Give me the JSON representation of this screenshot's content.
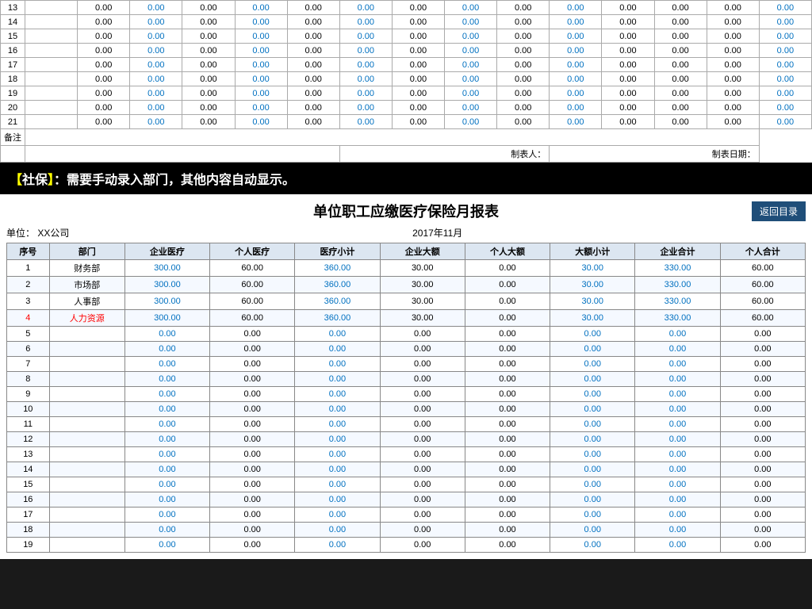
{
  "top": {
    "rows": [
      {
        "num": "13",
        "vals": [
          "",
          "0.00",
          "0.00",
          "0.00",
          "0.00",
          "0.00",
          "0.00",
          "0.00",
          "0.00",
          "0.00",
          "0.00",
          "0.00",
          "0.00",
          "0.00",
          "0.00"
        ]
      },
      {
        "num": "14",
        "vals": [
          "",
          "0.00",
          "0.00",
          "0.00",
          "0.00",
          "0.00",
          "0.00",
          "0.00",
          "0.00",
          "0.00",
          "0.00",
          "0.00",
          "0.00",
          "0.00",
          "0.00"
        ]
      },
      {
        "num": "15",
        "vals": [
          "",
          "0.00",
          "0.00",
          "0.00",
          "0.00",
          "0.00",
          "0.00",
          "0.00",
          "0.00",
          "0.00",
          "0.00",
          "0.00",
          "0.00",
          "0.00",
          "0.00"
        ]
      },
      {
        "num": "16",
        "vals": [
          "",
          "0.00",
          "0.00",
          "0.00",
          "0.00",
          "0.00",
          "0.00",
          "0.00",
          "0.00",
          "0.00",
          "0.00",
          "0.00",
          "0.00",
          "0.00",
          "0.00"
        ]
      },
      {
        "num": "17",
        "vals": [
          "",
          "0.00",
          "0.00",
          "0.00",
          "0.00",
          "0.00",
          "0.00",
          "0.00",
          "0.00",
          "0.00",
          "0.00",
          "0.00",
          "0.00",
          "0.00",
          "0.00"
        ]
      },
      {
        "num": "18",
        "vals": [
          "",
          "0.00",
          "0.00",
          "0.00",
          "0.00",
          "0.00",
          "0.00",
          "0.00",
          "0.00",
          "0.00",
          "0.00",
          "0.00",
          "0.00",
          "0.00",
          "0.00"
        ]
      },
      {
        "num": "19",
        "vals": [
          "",
          "0.00",
          "0.00",
          "0.00",
          "0.00",
          "0.00",
          "0.00",
          "0.00",
          "0.00",
          "0.00",
          "0.00",
          "0.00",
          "0.00",
          "0.00",
          "0.00"
        ]
      },
      {
        "num": "20",
        "vals": [
          "",
          "0.00",
          "0.00",
          "0.00",
          "0.00",
          "0.00",
          "0.00",
          "0.00",
          "0.00",
          "0.00",
          "0.00",
          "0.00",
          "0.00",
          "0.00",
          "0.00"
        ]
      },
      {
        "num": "21",
        "vals": [
          "",
          "0.00",
          "0.00",
          "0.00",
          "0.00",
          "0.00",
          "0.00",
          "0.00",
          "0.00",
          "0.00",
          "0.00",
          "0.00",
          "0.00",
          "0.00",
          "0.00"
        ]
      }
    ],
    "beizhu_label": "备注",
    "footer_label_maker": "制表人：",
    "footer_label_date": "制表日期："
  },
  "banner": {
    "bracket_open": "【",
    "text1": "社保",
    "bracket_close": "】",
    "message": "：需要手动录入部门，其他内容自动显示。"
  },
  "bottom": {
    "title": "单位职工应缴医疗保险月报表",
    "return_btn": "返回目录",
    "company_label": "单位：",
    "company_name": "XX公司",
    "year_month": "2017年11月",
    "headers": [
      "序号",
      "部门",
      "企业医疗",
      "个人医疗",
      "医疗小计",
      "企业大额",
      "个人大额",
      "大额小计",
      "企业合计",
      "个人合计"
    ],
    "data_rows": [
      {
        "seq": "1",
        "dept": "财务部",
        "vals": [
          "300.00",
          "60.00",
          "360.00",
          "30.00",
          "0.00",
          "30.00",
          "330.00",
          "60.00"
        ],
        "highlight": false
      },
      {
        "seq": "2",
        "dept": "市场部",
        "vals": [
          "300.00",
          "60.00",
          "360.00",
          "30.00",
          "0.00",
          "30.00",
          "330.00",
          "60.00"
        ],
        "highlight": false
      },
      {
        "seq": "3",
        "dept": "人事部",
        "vals": [
          "300.00",
          "60.00",
          "360.00",
          "30.00",
          "0.00",
          "30.00",
          "330.00",
          "60.00"
        ],
        "highlight": false
      },
      {
        "seq": "4",
        "dept": "人力资源",
        "vals": [
          "300.00",
          "60.00",
          "360.00",
          "30.00",
          "0.00",
          "30.00",
          "330.00",
          "60.00"
        ],
        "highlight": true
      },
      {
        "seq": "5",
        "dept": "",
        "vals": [
          "0.00",
          "0.00",
          "0.00",
          "0.00",
          "0.00",
          "0.00",
          "0.00",
          "0.00"
        ],
        "highlight": false
      },
      {
        "seq": "6",
        "dept": "",
        "vals": [
          "0.00",
          "0.00",
          "0.00",
          "0.00",
          "0.00",
          "0.00",
          "0.00",
          "0.00"
        ],
        "highlight": false
      },
      {
        "seq": "7",
        "dept": "",
        "vals": [
          "0.00",
          "0.00",
          "0.00",
          "0.00",
          "0.00",
          "0.00",
          "0.00",
          "0.00"
        ],
        "highlight": false
      },
      {
        "seq": "8",
        "dept": "",
        "vals": [
          "0.00",
          "0.00",
          "0.00",
          "0.00",
          "0.00",
          "0.00",
          "0.00",
          "0.00"
        ],
        "highlight": false
      },
      {
        "seq": "9",
        "dept": "",
        "vals": [
          "0.00",
          "0.00",
          "0.00",
          "0.00",
          "0.00",
          "0.00",
          "0.00",
          "0.00"
        ],
        "highlight": false
      },
      {
        "seq": "10",
        "dept": "",
        "vals": [
          "0.00",
          "0.00",
          "0.00",
          "0.00",
          "0.00",
          "0.00",
          "0.00",
          "0.00"
        ],
        "highlight": false
      },
      {
        "seq": "11",
        "dept": "",
        "vals": [
          "0.00",
          "0.00",
          "0.00",
          "0.00",
          "0.00",
          "0.00",
          "0.00",
          "0.00"
        ],
        "highlight": false
      },
      {
        "seq": "12",
        "dept": "",
        "vals": [
          "0.00",
          "0.00",
          "0.00",
          "0.00",
          "0.00",
          "0.00",
          "0.00",
          "0.00"
        ],
        "highlight": false
      },
      {
        "seq": "13",
        "dept": "",
        "vals": [
          "0.00",
          "0.00",
          "0.00",
          "0.00",
          "0.00",
          "0.00",
          "0.00",
          "0.00"
        ],
        "highlight": false
      },
      {
        "seq": "14",
        "dept": "",
        "vals": [
          "0.00",
          "0.00",
          "0.00",
          "0.00",
          "0.00",
          "0.00",
          "0.00",
          "0.00"
        ],
        "highlight": false
      },
      {
        "seq": "15",
        "dept": "",
        "vals": [
          "0.00",
          "0.00",
          "0.00",
          "0.00",
          "0.00",
          "0.00",
          "0.00",
          "0.00"
        ],
        "highlight": false
      },
      {
        "seq": "16",
        "dept": "",
        "vals": [
          "0.00",
          "0.00",
          "0.00",
          "0.00",
          "0.00",
          "0.00",
          "0.00",
          "0.00"
        ],
        "highlight": false
      },
      {
        "seq": "17",
        "dept": "",
        "vals": [
          "0.00",
          "0.00",
          "0.00",
          "0.00",
          "0.00",
          "0.00",
          "0.00",
          "0.00"
        ],
        "highlight": false
      },
      {
        "seq": "18",
        "dept": "",
        "vals": [
          "0.00",
          "0.00",
          "0.00",
          "0.00",
          "0.00",
          "0.00",
          "0.00",
          "0.00"
        ],
        "highlight": false
      },
      {
        "seq": "19",
        "dept": "",
        "vals": [
          "0.00",
          "0.00",
          "0.00",
          "0.00",
          "0.00",
          "0.00",
          "0.00",
          "0.00"
        ],
        "highlight": false
      }
    ]
  }
}
